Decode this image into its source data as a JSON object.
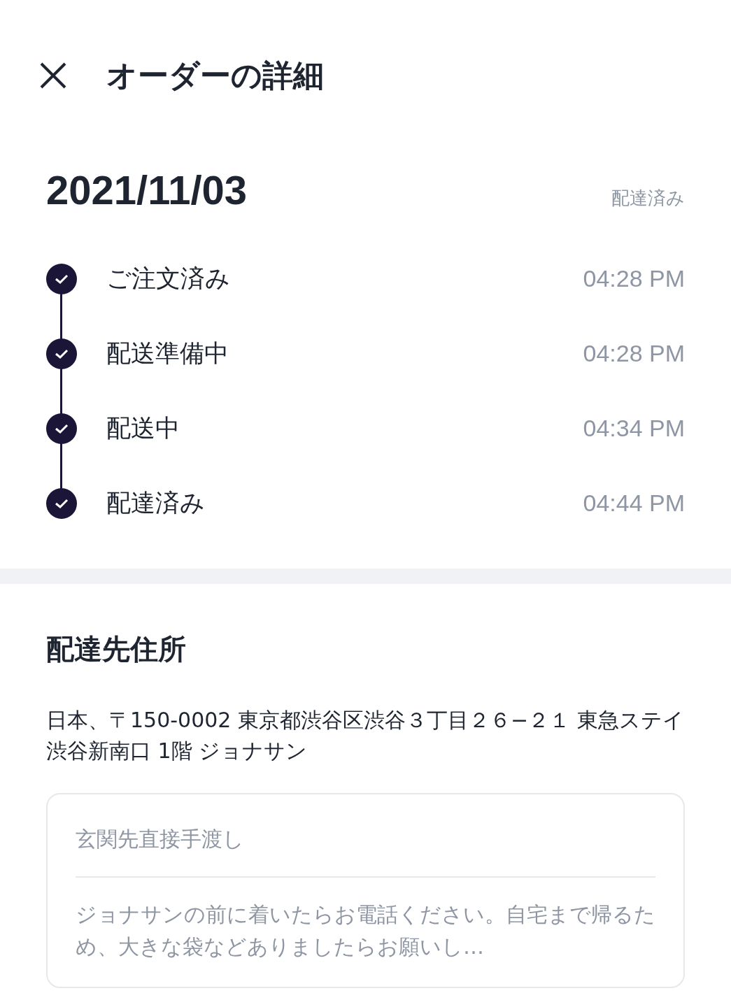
{
  "header": {
    "title": "オーダーの詳細"
  },
  "order": {
    "date": "2021/11/03",
    "status": "配達済み"
  },
  "timeline": [
    {
      "label": "ご注文済み",
      "time": "04:28 PM",
      "done": true
    },
    {
      "label": "配送準備中",
      "time": "04:28 PM",
      "done": true
    },
    {
      "label": "配送中",
      "time": "04:34 PM",
      "done": true
    },
    {
      "label": "配達済み",
      "time": "04:44 PM",
      "done": true
    }
  ],
  "address": {
    "heading": "配達先住所",
    "text": "日本、〒150-0002 東京都渋谷区渋谷３丁目２６−２１ 東急ステイ渋谷新南口 1階 ジョナサン"
  },
  "delivery_note": {
    "method": "玄関先直接手渡し",
    "note": "ジョナサンの前に着いたらお電話ください。自宅まで帰るため、大きな袋などありましたらお願いし…"
  }
}
